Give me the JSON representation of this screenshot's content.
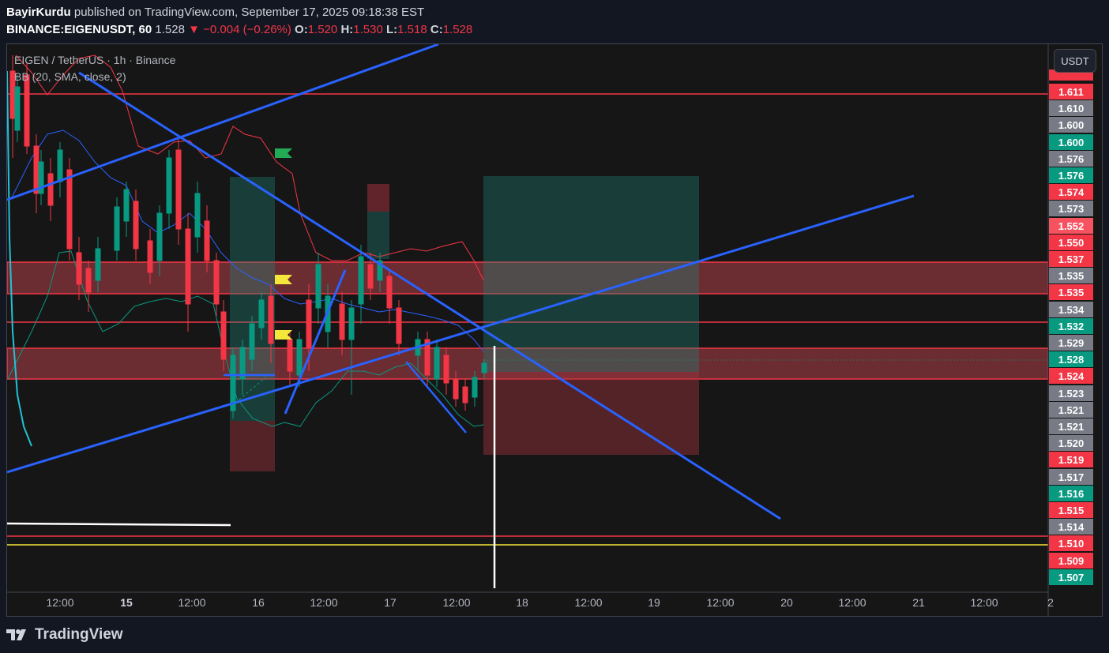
{
  "header": {
    "author": "BayirKurdu",
    "published_text": "published on TradingView.com, September 17, 2025 09:18:38 EST",
    "symbol": "BINANCE:EIGENUSDT, 60",
    "last": "1.528",
    "arrow": "▼",
    "change": "−0.004 (−0.26%)",
    "open_label": "O:",
    "open": "1.520",
    "high_label": "H:",
    "high": "1.530",
    "low_label": "L:",
    "low": "1.518",
    "close_label": "C:",
    "close": "1.528"
  },
  "legend": {
    "title": "EIGEN / TetherUS · 1h · Binance",
    "indicator": "BB (20, SMA, close, 2)"
  },
  "currency_button": "USDT",
  "colors": {
    "up": "#089981",
    "down": "#f23645",
    "grey": "#787b86",
    "trend": "#2962ff",
    "bb_upper": "#f23645",
    "bb_basis": "#2962ff",
    "bb_lower": "#089981"
  },
  "price_labels": [
    {
      "text": "1.611",
      "color": "#f23645"
    },
    {
      "text": "1.610",
      "color": "#787b86"
    },
    {
      "text": "1.600",
      "color": "#787b86"
    },
    {
      "text": "1.600",
      "color": "#089981"
    },
    {
      "text": "1.576",
      "color": "#787b86"
    },
    {
      "text": "1.576",
      "color": "#089981"
    },
    {
      "text": "1.574",
      "color": "#f23645"
    },
    {
      "text": "1.573",
      "color": "#787b86"
    },
    {
      "text": "1.552",
      "color": "#f7525f"
    },
    {
      "text": "1.550",
      "color": "#f23645"
    },
    {
      "text": "1.537",
      "color": "#f23645"
    },
    {
      "text": "1.535",
      "color": "#787b86"
    },
    {
      "text": "1.535",
      "color": "#f23645"
    },
    {
      "text": "1.534",
      "color": "#787b86"
    },
    {
      "text": "1.532",
      "color": "#089981"
    },
    {
      "text": "1.529",
      "color": "#787b86"
    },
    {
      "text": "1.528",
      "color": "#089981"
    },
    {
      "text": "1.524",
      "color": "#f23645"
    },
    {
      "text": "1.523",
      "color": "#787b86"
    },
    {
      "text": "1.521",
      "color": "#787b86"
    },
    {
      "text": "1.521",
      "color": "#787b86"
    },
    {
      "text": "1.520",
      "color": "#787b86"
    },
    {
      "text": "1.519",
      "color": "#f23645"
    },
    {
      "text": "1.517",
      "color": "#787b86"
    },
    {
      "text": "1.516",
      "color": "#089981"
    },
    {
      "text": "1.515",
      "color": "#f23645"
    },
    {
      "text": "1.514",
      "color": "#787b86"
    },
    {
      "text": "1.510",
      "color": "#f23645"
    },
    {
      "text": "1.509",
      "color": "#f23645"
    },
    {
      "text": "1.507",
      "color": "#089981"
    }
  ],
  "time_labels": [
    {
      "text": "12:00",
      "bold": false
    },
    {
      "text": "15",
      "bold": true
    },
    {
      "text": "12:00",
      "bold": false
    },
    {
      "text": "16",
      "bold": false
    },
    {
      "text": "12:00",
      "bold": false
    },
    {
      "text": "17",
      "bold": false
    },
    {
      "text": "12:00",
      "bold": false
    },
    {
      "text": "18",
      "bold": false
    },
    {
      "text": "12:00",
      "bold": false
    },
    {
      "text": "19",
      "bold": false
    },
    {
      "text": "12:00",
      "bold": false
    },
    {
      "text": "20",
      "bold": false
    },
    {
      "text": "12:00",
      "bold": false
    },
    {
      "text": "21",
      "bold": false
    },
    {
      "text": "12:00",
      "bold": false
    },
    {
      "text": "2",
      "bold": false
    }
  ],
  "footer": {
    "brand": "TradingView",
    "logo_icon": "tradingview-logo-icon"
  }
}
